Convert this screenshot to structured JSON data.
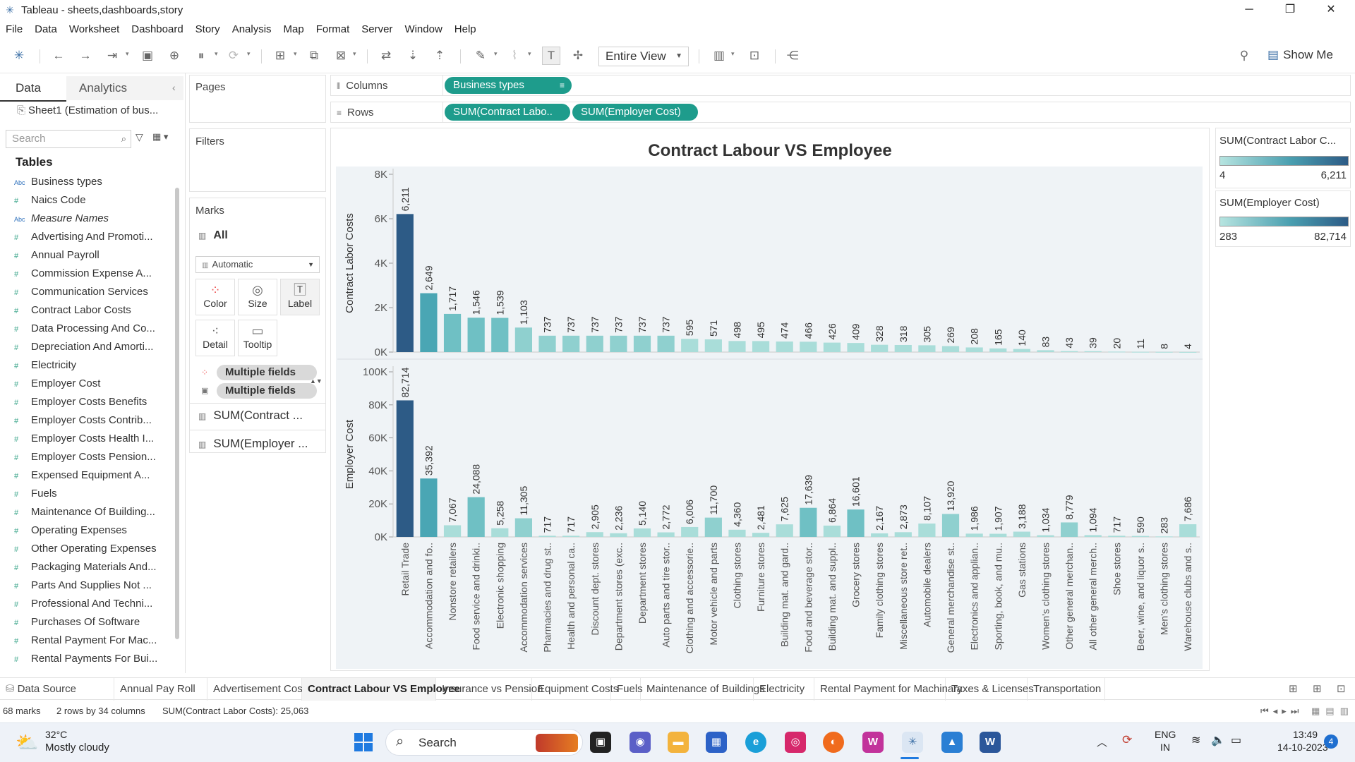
{
  "window": {
    "title": "Tableau - sheets,dashboards,story"
  },
  "menu": [
    "File",
    "Data",
    "Worksheet",
    "Dashboard",
    "Story",
    "Analysis",
    "Map",
    "Format",
    "Server",
    "Window",
    "Help"
  ],
  "toolbar": {
    "fit_label": "Entire View",
    "show_me_label": "Show Me"
  },
  "data_pane": {
    "tab_data": "Data",
    "tab_analytics": "Analytics",
    "datasource": "Sheet1 (Estimation of bus...",
    "search_placeholder": "Search",
    "tables_heading": "Tables",
    "fields": [
      {
        "icon": "Abc",
        "name": "Business types"
      },
      {
        "icon": "#",
        "name": "Naics Code"
      },
      {
        "icon": "Abc",
        "name": "Measure Names"
      },
      {
        "icon": "#",
        "name": "Advertising And Promoti..."
      },
      {
        "icon": "#",
        "name": "Annual Payroll"
      },
      {
        "icon": "#",
        "name": "Commission Expense A..."
      },
      {
        "icon": "#",
        "name": "Communication Services"
      },
      {
        "icon": "#",
        "name": "Contract Labor Costs"
      },
      {
        "icon": "#",
        "name": "Data Processing And Co..."
      },
      {
        "icon": "#",
        "name": "Depreciation And Amorti..."
      },
      {
        "icon": "#",
        "name": "Electricity"
      },
      {
        "icon": "#",
        "name": "Employer Cost"
      },
      {
        "icon": "#",
        "name": "Employer Costs Benefits"
      },
      {
        "icon": "#",
        "name": "Employer Costs Contrib..."
      },
      {
        "icon": "#",
        "name": "Employer Costs Health I..."
      },
      {
        "icon": "#",
        "name": "Employer Costs Pension..."
      },
      {
        "icon": "#",
        "name": "Expensed Equipment A..."
      },
      {
        "icon": "#",
        "name": "Fuels"
      },
      {
        "icon": "#",
        "name": "Maintenance Of Building..."
      },
      {
        "icon": "#",
        "name": "Operating Expenses"
      },
      {
        "icon": "#",
        "name": "Other Operating Expenses"
      },
      {
        "icon": "#",
        "name": "Packaging Materials And..."
      },
      {
        "icon": "#",
        "name": "Parts And Supplies Not ..."
      },
      {
        "icon": "#",
        "name": "Professional And Techni..."
      },
      {
        "icon": "#",
        "name": "Purchases Of Software"
      },
      {
        "icon": "#",
        "name": "Rental Payment For Mac..."
      },
      {
        "icon": "#",
        "name": "Rental Payments For Bui..."
      }
    ]
  },
  "cards": {
    "pages": "Pages",
    "filters": "Filters",
    "marks": "Marks",
    "marks_all": "All",
    "mark_type": "Automatic",
    "btn_color": "Color",
    "btn_size": "Size",
    "btn_label": "Label",
    "btn_detail": "Detail",
    "btn_tooltip": "Tooltip",
    "pill_multi_1": "Multiple fields",
    "pill_multi_2": "Multiple fields",
    "measure_1": "SUM(Contract ...",
    "measure_2": "SUM(Employer ..."
  },
  "shelves": {
    "columns_label": "Columns",
    "rows_label": "Rows",
    "columns_pill": "Business types",
    "rows_pill_1": "SUM(Contract Labo..",
    "rows_pill_2": "SUM(Employer Cost)"
  },
  "legends": [
    {
      "title": "SUM(Contract Labor C...",
      "min": "4",
      "max": "6,211"
    },
    {
      "title": "SUM(Employer Cost)",
      "min": "283",
      "max": "82,714"
    }
  ],
  "colors": {
    "pill_green": "#1e9c8c",
    "bar_dark": "#2d5b86",
    "bar_light": "#a9ddd9"
  },
  "chart_data": {
    "type": "bar",
    "title": "Contract Labour VS Employee",
    "categories": [
      "Retail Trade",
      "Accommodation and fo..",
      "Nonstore retailers",
      "Food service and drinki..",
      "Electronic shopping",
      "Accommodation services",
      "Pharmacies and drug st..",
      "Health and personal ca..",
      "Discount dept. stores",
      "Department stores (exc..",
      "Department stores",
      "Auto parts and tire stor..",
      "Clothing and accessorie..",
      "Motor vehicle and parts",
      "Clothing stores",
      "Furniture stores",
      "Building mat. and gard..",
      "Food and beverage stor..",
      "Building mat. and suppl..",
      "Grocery stores",
      "Family clothing stores",
      "Miscellaneous store ret..",
      "Automobile dealers",
      "General merchandise st..",
      "Electronics and applian..",
      "Sporting, book, and mu..",
      "Gas stations",
      "Women's clothing stores",
      "Other general merchan..",
      "All other general merch..",
      "Shoe stores",
      "Beer, wine, and liquor s..",
      "Men's clothing stores",
      "Warehouse clubs and s.."
    ],
    "series": [
      {
        "name": "Contract Labor Costs",
        "labels": [
          "6,211",
          "2,649",
          "1,717",
          "1,546",
          "1,539",
          "1,103",
          "737",
          "737",
          "737",
          "737",
          "737",
          "737",
          "595",
          "571",
          "498",
          "495",
          "474",
          "466",
          "426",
          "409",
          "328",
          "318",
          "305",
          "269",
          "208",
          "165",
          "140",
          "83",
          "43",
          "39",
          "20",
          "11",
          "8",
          "4"
        ],
        "values": [
          6211,
          2649,
          1717,
          1546,
          1539,
          1103,
          737,
          737,
          737,
          737,
          737,
          737,
          595,
          571,
          498,
          495,
          474,
          466,
          426,
          409,
          328,
          318,
          305,
          269,
          208,
          165,
          140,
          83,
          43,
          39,
          20,
          11,
          8,
          4
        ],
        "ylim": [
          0,
          8000
        ],
        "ticks": [
          {
            "v": 0,
            "label": "0K"
          },
          {
            "v": 2000,
            "label": "2K"
          },
          {
            "v": 4000,
            "label": "4K"
          },
          {
            "v": 6000,
            "label": "6K"
          },
          {
            "v": 8000,
            "label": "8K"
          }
        ]
      },
      {
        "name": "Employer Cost",
        "labels": [
          "82,714",
          "35,392",
          "7,067",
          "24,088",
          "5,258",
          "11,305",
          "717",
          "717",
          "2,905",
          "2,236",
          "5,140",
          "2,772",
          "6,006",
          "11,700",
          "4,360",
          "2,481",
          "7,625",
          "17,639",
          "6,864",
          "16,601",
          "2,167",
          "2,873",
          "8,107",
          "13,920",
          "1,986",
          "1,907",
          "3,188",
          "1,034",
          "8,779",
          "1,094",
          "717",
          "590",
          "283",
          "7,686"
        ],
        "values": [
          82714,
          35392,
          7067,
          24088,
          5258,
          11305,
          717,
          717,
          2905,
          2236,
          5140,
          2772,
          6006,
          11700,
          4360,
          2481,
          7625,
          17639,
          6864,
          16601,
          2167,
          2873,
          8107,
          13920,
          1986,
          1907,
          3188,
          1034,
          8779,
          1094,
          717,
          590,
          283,
          7686
        ],
        "ylim": [
          0,
          100000
        ],
        "ticks": [
          {
            "v": 0,
            "label": "0K"
          },
          {
            "v": 20000,
            "label": "20K"
          },
          {
            "v": 40000,
            "label": "40K"
          },
          {
            "v": 60000,
            "label": "60K"
          },
          {
            "v": 80000,
            "label": "80K"
          },
          {
            "v": 100000,
            "label": "100K"
          }
        ]
      }
    ]
  },
  "sheet_tabs": {
    "datasource": "Data Source",
    "tabs": [
      "Annual Pay Roll",
      "Advertisement Costs",
      "Contract Labour VS Employee",
      "Insurance vs Pension",
      "Equipment Costs",
      "Fuels",
      "Maintenance of Buildings",
      "Electricity",
      "Rental Payment for Machinary",
      "Taxes & Licenses",
      "Transportation ar"
    ]
  },
  "status": {
    "marks": "68 marks",
    "dims": "2 rows by 34 columns",
    "sum": "SUM(Contract Labor Costs): 25,063"
  },
  "taskbar": {
    "weather_temp": "32°C",
    "weather_desc": "Mostly cloudy",
    "search": "Search",
    "lang_1": "ENG",
    "lang_2": "IN",
    "time": "13:49",
    "date": "14-10-2023",
    "notif": "4"
  }
}
